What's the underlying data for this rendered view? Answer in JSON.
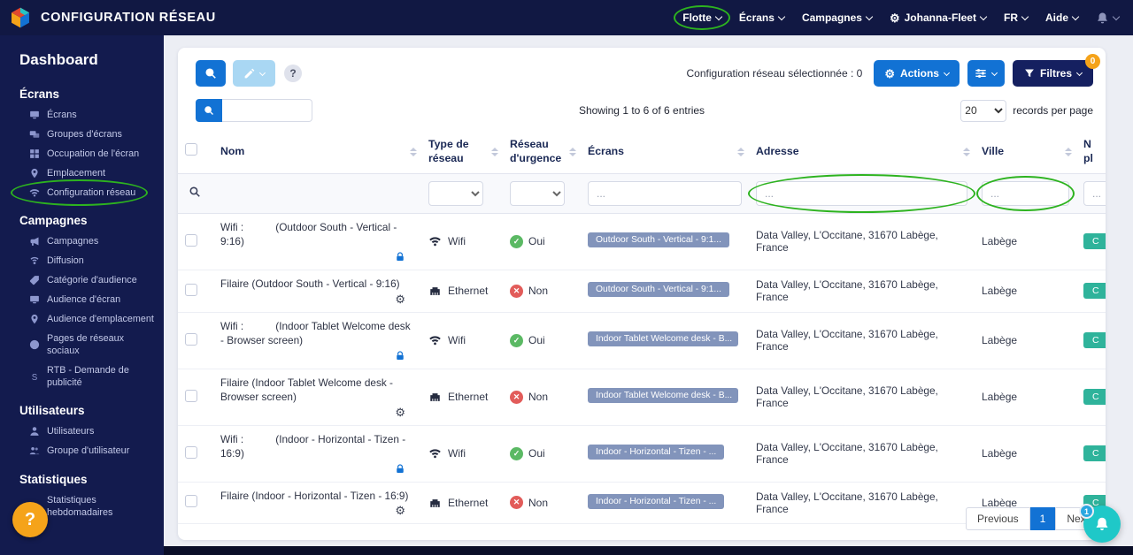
{
  "topbar": {
    "title": "CONFIGURATION RÉSEAU",
    "nav": [
      {
        "id": "flotte",
        "label": "Flotte",
        "annotated": true
      },
      {
        "id": "ecrans",
        "label": "Écrans"
      },
      {
        "id": "campagnes",
        "label": "Campagnes"
      },
      {
        "id": "johanna-fleet",
        "label": "Johanna-Fleet",
        "icon": "gear"
      },
      {
        "id": "langue",
        "label": "FR"
      },
      {
        "id": "aide",
        "label": "Aide"
      }
    ]
  },
  "sidebar": {
    "title": "Dashboard",
    "help": "?",
    "items": [
      {
        "kind": "heading",
        "label": "Écrans"
      },
      {
        "kind": "item",
        "icon": "monitor",
        "label": "Écrans"
      },
      {
        "kind": "item",
        "icon": "monitors",
        "label": "Groupes d'écrans"
      },
      {
        "kind": "item",
        "icon": "grid",
        "label": "Occupation de l'écran"
      },
      {
        "kind": "item",
        "icon": "pin",
        "label": "Emplacement"
      },
      {
        "kind": "item",
        "icon": "wifi",
        "label": "Configuration réseau",
        "active": true
      },
      {
        "kind": "heading",
        "label": "Campagnes"
      },
      {
        "kind": "item",
        "icon": "megaphone",
        "label": "Campagnes"
      },
      {
        "kind": "item",
        "icon": "signal",
        "label": "Diffusion"
      },
      {
        "kind": "item",
        "icon": "tag",
        "label": "Catégorie d'audience"
      },
      {
        "kind": "item",
        "icon": "monitor",
        "label": "Audience d'écran"
      },
      {
        "kind": "item",
        "icon": "pin",
        "label": "Audience d'emplacement"
      },
      {
        "kind": "item",
        "icon": "globe",
        "label": "Pages de réseaux sociaux"
      },
      {
        "kind": "item",
        "icon": "dollar",
        "label": "RTB - Demande de publicité"
      },
      {
        "kind": "heading",
        "label": "Utilisateurs"
      },
      {
        "kind": "item",
        "icon": "user",
        "label": "Utilisateurs"
      },
      {
        "kind": "item",
        "icon": "users",
        "label": "Groupe d'utilisateur"
      },
      {
        "kind": "heading",
        "label": "Statistiques"
      },
      {
        "kind": "item",
        "icon": "chart",
        "label": "Statistiques hebdomadaires"
      }
    ]
  },
  "toolbar": {
    "selected_text": "Configuration réseau sélectionnée : 0",
    "actions_label": "Actions",
    "filters_label": "Filtres",
    "filters_badge": "0",
    "help_label": "?"
  },
  "listbar": {
    "showing": "Showing 1 to 6 of 6 entries",
    "page_size": "20",
    "records_label": "records per page"
  },
  "table": {
    "columns": [
      "Nom",
      "Type de réseau",
      "Réseau d'urgence",
      "Écrans",
      "Adresse",
      "Ville",
      "N\npl"
    ],
    "filter_placeholder": "...",
    "rows": [
      {
        "name": "Wifi :           (Outdoor South - Vertical - 9:16)",
        "name_icon": "lock",
        "type": "Wifi",
        "type_icon": "wifi",
        "urgence": "Oui",
        "urgence_ok": true,
        "screens": "Outdoor South - Vertical - 9:1...",
        "address": "Data Valley, L'Occitane, 31670 Labège, France",
        "city": "Labège",
        "last": "C"
      },
      {
        "name": "Filaire (Outdoor South - Vertical - 9:16)",
        "name_icon": "gear",
        "type": "Ethernet",
        "type_icon": "ethernet",
        "urgence": "Non",
        "urgence_ok": false,
        "screens": "Outdoor South - Vertical - 9:1...",
        "address": "Data Valley, L'Occitane, 31670 Labège, France",
        "city": "Labège",
        "last": "C"
      },
      {
        "name": "Wifi :           (Indoor Tablet Welcome desk - Browser screen)",
        "name_icon": "lock",
        "type": "Wifi",
        "type_icon": "wifi",
        "urgence": "Oui",
        "urgence_ok": true,
        "screens": "Indoor Tablet Welcome desk - B...",
        "address": "Data Valley, L'Occitane, 31670 Labège, France",
        "city": "Labège",
        "last": "C"
      },
      {
        "name": "Filaire (Indoor Tablet Welcome desk - Browser screen)",
        "name_icon": "gear",
        "type": "Ethernet",
        "type_icon": "ethernet",
        "urgence": "Non",
        "urgence_ok": false,
        "screens": "Indoor Tablet Welcome desk - B...",
        "address": "Data Valley, L'Occitane, 31670 Labège, France",
        "city": "Labège",
        "last": "C"
      },
      {
        "name": "Wifi :           (Indoor - Horizontal - Tizen - 16:9)",
        "name_icon": "lock",
        "type": "Wifi",
        "type_icon": "wifi",
        "urgence": "Oui",
        "urgence_ok": true,
        "screens": "Indoor - Horizontal - Tizen - ...",
        "address": "Data Valley, L'Occitane, 31670 Labège, France",
        "city": "Labège",
        "last": "C"
      },
      {
        "name": "Filaire (Indoor - Horizontal - Tizen - 16:9)",
        "name_icon": "gear",
        "type": "Ethernet",
        "type_icon": "ethernet",
        "urgence": "Non",
        "urgence_ok": false,
        "screens": "Indoor - Horizontal - Tizen - ...",
        "address": "Data Valley, L'Occitane, 31670 Labège, France",
        "city": "Labège",
        "last": "C"
      }
    ],
    "annotated_filters": [
      "adresse",
      "ville"
    ]
  },
  "pagination": {
    "previous": "Previous",
    "page": "1",
    "next": "Next"
  },
  "fab": {
    "badge": "1"
  },
  "colors": {
    "primary": "#1272d4",
    "navy": "#131b4e",
    "orange": "#f5a31a",
    "teal": "#1fc8c8",
    "annotation": "#2db31f"
  }
}
